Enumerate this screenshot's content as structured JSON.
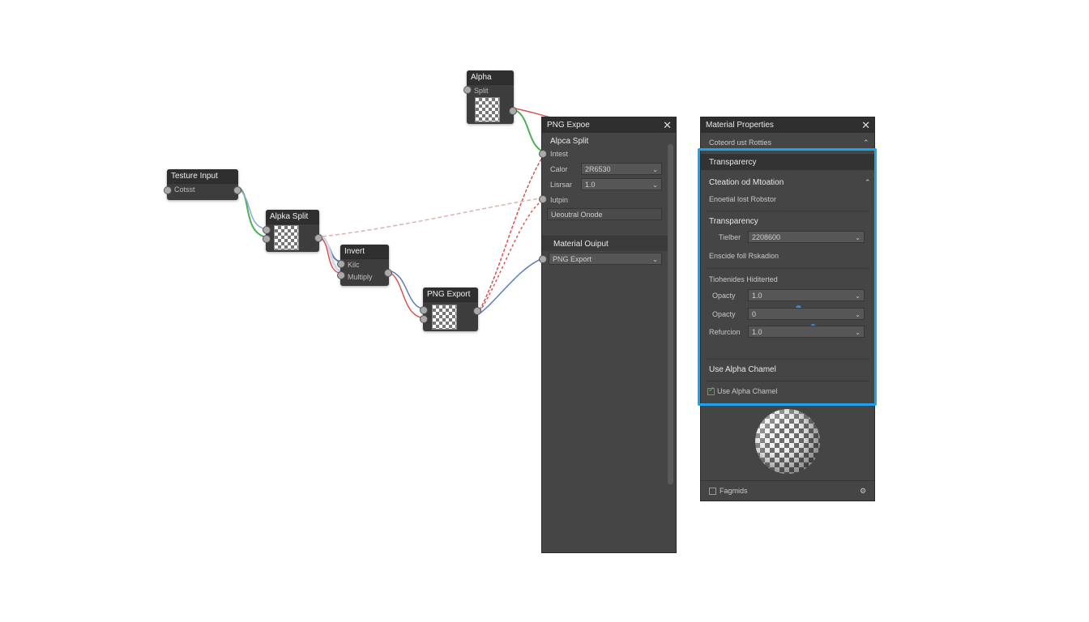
{
  "colors": {
    "accent": "#1aa3f0",
    "wire_green": "#4caf50",
    "wire_red": "#d9534f",
    "wire_blue": "#5b7fb8"
  },
  "nodes": {
    "texture_input": {
      "title": "Testure Input",
      "row": "Cotsst"
    },
    "alpha_split": {
      "title": "Alpka Split"
    },
    "invert": {
      "title": "Invert",
      "row1": "Kilc",
      "row2": "Multiply"
    },
    "png_export": {
      "title": "PNG Export"
    },
    "alpha": {
      "title": "Alpha",
      "row": "Split"
    }
  },
  "png_panel": {
    "title": "PNG Expoe",
    "section1_title": "Alpca Split",
    "input_label": "Intest",
    "color_label": "Calor",
    "color_value": "2R6530",
    "linear_label": "Lisrsar",
    "linear_value": "1.0",
    "alpha_label": "Iutpin",
    "neutral_label": "Ueoutral Onode",
    "section2_title": "Material Ouiput",
    "export_value": "PNG Export"
  },
  "material_panel": {
    "title": "Material Properties",
    "collapsed_label": "Coteord ust Rotties",
    "transparency_header": "Transparercy",
    "creation_label": "Cteation od Mtoation",
    "essential_label": "Enoetial lost Robstor",
    "transparency_sub": "Transparency",
    "tielber_label": "Tielber",
    "tielber_value": "2208600",
    "enscide_label": "Enscide foll Rskadion",
    "tiohenides_label": "Tiohenides Hiditerted",
    "opacity1_label": "Opacty",
    "opacity1_value": "1.0",
    "opacity2_label": "Opacty",
    "opacity2_value": "0",
    "refraction_label": "Refurcion",
    "refraction_value": "1.0",
    "use_alpha_label": "Use Alpha Chamel",
    "use_alpha_checkbox_label": "Use Alpha Chamel",
    "footer_label": "Fagmids",
    "preview_icon": "sphere-preview"
  }
}
